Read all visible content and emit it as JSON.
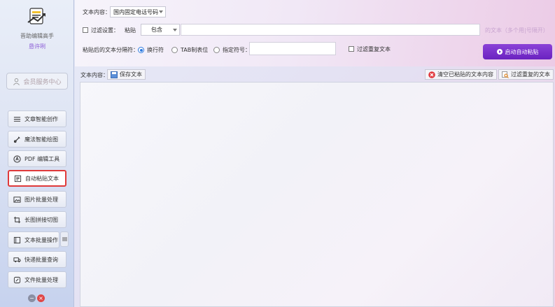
{
  "sidebar": {
    "app_name": "晋助编辑高手",
    "user": "恳许咧",
    "member_button": "会员服务中心",
    "items": [
      {
        "label": "文章智能创作",
        "icon": "lines-icon"
      },
      {
        "label": "魔法智能绘图",
        "icon": "magic-brush-icon"
      },
      {
        "label": "PDF 编辑工具",
        "icon": "pdf-icon"
      },
      {
        "label": "自动粘贴文本",
        "icon": "paste-doc-icon",
        "active": true
      },
      {
        "label": "图片批量处理",
        "icon": "image-icon"
      },
      {
        "label": "长图拼接切图",
        "icon": "crop-icon"
      },
      {
        "label": "文本批量操作",
        "icon": "text-batch-icon"
      },
      {
        "label": "快递批量查询",
        "icon": "truck-icon"
      },
      {
        "label": "文件批量处理",
        "icon": "file-batch-icon"
      }
    ]
  },
  "top": {
    "content_label": "文本内容：",
    "content_select": "国内固定电话号码",
    "filter_label": "过滤设置：",
    "filter_paste_label": "粘贴",
    "filter_mode": "包含",
    "filter_hint": "的文本（多个用|号隔开）",
    "separator_label": "粘贴后的文本分隔符：",
    "radio_newline": "换行符",
    "radio_tab": "TAB制表位",
    "radio_custom": "指定符号：",
    "dedupe_label": "过滤重复文本",
    "start_button": "启动自动粘贴"
  },
  "content": {
    "label": "文本内容：",
    "save_button": "保存文本",
    "clear_button": "清空已粘贴的文本内容",
    "dedupe_button": "过滤重复的文本"
  },
  "colors": {
    "accent_purple": "#7a30cc",
    "active_border": "#e03a3a",
    "radio_blue": "#2d7be0"
  }
}
